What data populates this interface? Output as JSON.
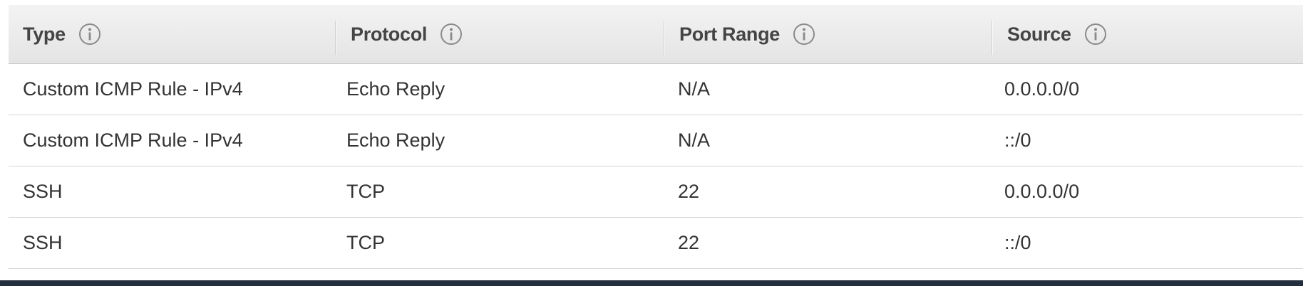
{
  "table": {
    "columns": [
      {
        "label": "Type",
        "info_icon": "info-circle-icon"
      },
      {
        "label": "Protocol",
        "info_icon": "info-circle-icon"
      },
      {
        "label": "Port Range",
        "info_icon": "info-circle-icon"
      },
      {
        "label": "Source",
        "info_icon": "info-circle-icon"
      }
    ],
    "rows": [
      {
        "type": "Custom ICMP Rule - IPv4",
        "protocol": "Echo Reply",
        "port_range": "N/A",
        "source": "0.0.0.0/0"
      },
      {
        "type": "Custom ICMP Rule - IPv4",
        "protocol": "Echo Reply",
        "port_range": "N/A",
        "source": "::/0"
      },
      {
        "type": "SSH",
        "protocol": "TCP",
        "port_range": "22",
        "source": "0.0.0.0/0"
      },
      {
        "type": "SSH",
        "protocol": "TCP",
        "port_range": "22",
        "source": "::/0"
      }
    ]
  },
  "colors": {
    "header_bg": "#e8e8e8",
    "header_text": "#444444",
    "body_text": "#333333",
    "row_border": "#d5d5d5",
    "footer_bar": "#232f3e"
  }
}
